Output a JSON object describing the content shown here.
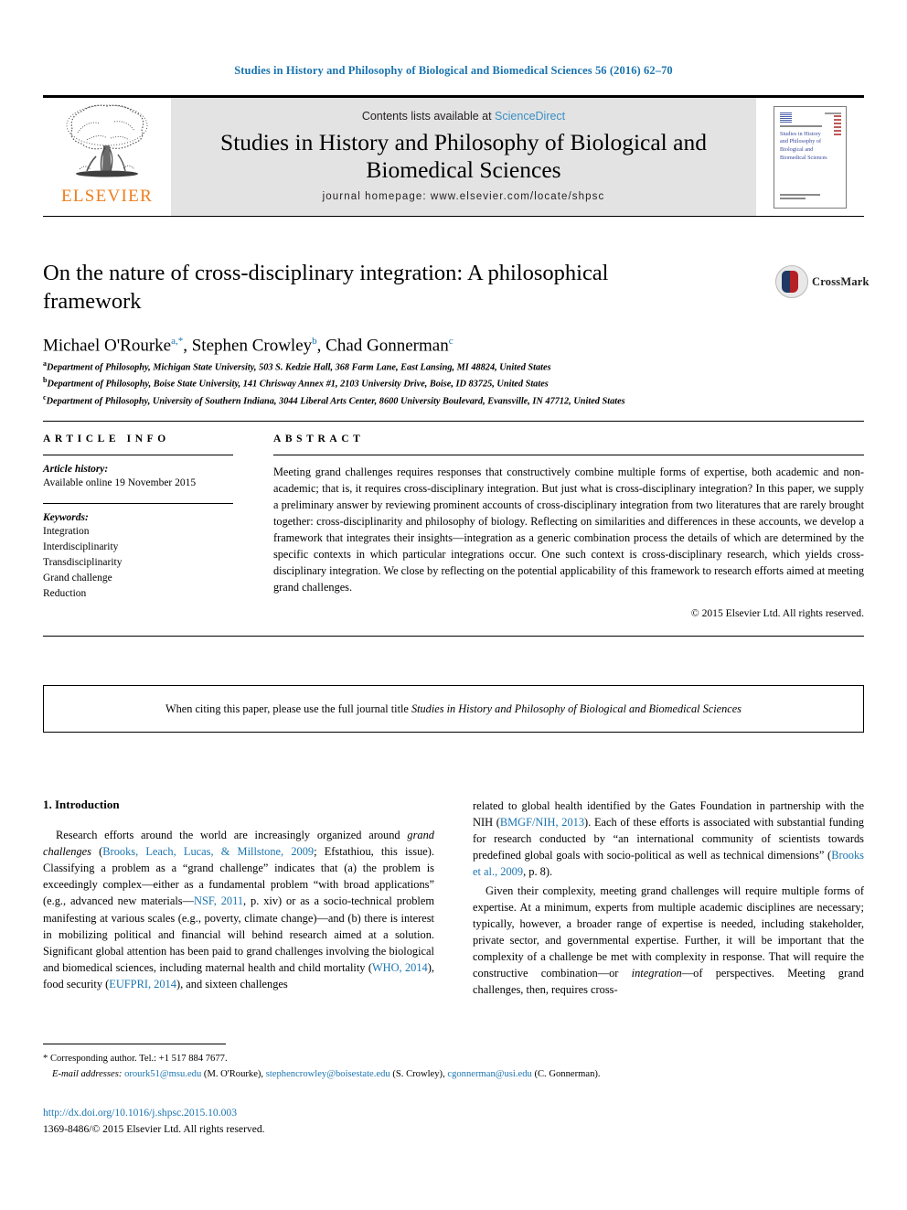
{
  "running_head": "Studies in History and Philosophy of Biological and Biomedical Sciences 56 (2016) 62–70",
  "masthead": {
    "contents_prefix": "Contents lists available at ",
    "sciencedirect": "ScienceDirect",
    "journal_title": "Studies in History and Philosophy of Biological and Biomedical Sciences",
    "homepage": "journal homepage: www.elsevier.com/locate/shpsc",
    "publisher_word": "ELSEVIER",
    "cover_title": "Studies in History and Philosophy of Biological and Biomedical Sciences"
  },
  "article": {
    "title": "On the nature of cross-disciplinary integration: A philosophical framework",
    "authors_html": "Michael O'Rourke<sup>a,*</sup>, Stephen Crowley<sup>b</sup>, Chad Gonnerman<sup>c</sup>",
    "crossmark_label": "CrossMark",
    "affiliations": [
      {
        "marker": "a",
        "text": "Department of Philosophy, Michigan State University, 503 S. Kedzie Hall, 368 Farm Lane, East Lansing, MI 48824, United States"
      },
      {
        "marker": "b",
        "text": "Department of Philosophy, Boise State University, 141 Chrisway Annex #1, 2103 University Drive, Boise, ID 83725, United States"
      },
      {
        "marker": "c",
        "text": "Department of Philosophy, University of Southern Indiana, 3044 Liberal Arts Center, 8600 University Boulevard, Evansville, IN 47712, United States"
      }
    ]
  },
  "article_info": {
    "heading": "ARTICLE INFO",
    "history_label": "Article history:",
    "history_value": "Available online 19 November 2015",
    "keywords_label": "Keywords:",
    "keywords": [
      "Integration",
      "Interdisciplinarity",
      "Transdisciplinarity",
      "Grand challenge",
      "Reduction"
    ]
  },
  "abstract": {
    "heading": "ABSTRACT",
    "body": "Meeting grand challenges requires responses that constructively combine multiple forms of expertise, both academic and non-academic; that is, it requires cross-disciplinary integration. But just what is cross-disciplinary integration? In this paper, we supply a preliminary answer by reviewing prominent accounts of cross-disciplinary integration from two literatures that are rarely brought together: cross-disciplinarity and philosophy of biology. Reflecting on similarities and differences in these accounts, we develop a framework that integrates their insights—integration as a generic combination process the details of which are determined by the specific contexts in which particular integrations occur. One such context is cross-disciplinary research, which yields cross-disciplinary integration. We close by reflecting on the potential applicability of this framework to research efforts aimed at meeting grand challenges.",
    "copyright": "© 2015 Elsevier Ltd. All rights reserved."
  },
  "citation_notice": {
    "prefix": "When citing this paper, please use the full journal title ",
    "journal": "Studies in History and Philosophy of Biological and Biomedical Sciences"
  },
  "introduction": {
    "heading": "1. Introduction",
    "left_paragraph_1_part1": "Research efforts around the world are increasingly organized around ",
    "left_paragraph_1_italic": "grand challenges",
    "left_paragraph_1_part2": " (",
    "left_ref_1": "Brooks, Leach, Lucas, & Millstone, 2009",
    "left_paragraph_1_part3": "; Efstathiou, this issue). Classifying a problem as a “grand challenge” indicates that (a) the problem is exceedingly complex—either as a fundamental problem “with broad applications” (e.g., advanced new materials—",
    "left_ref_2": "NSF, 2011",
    "left_paragraph_1_part4": ", p. xiv) or as a socio-technical problem manifesting at various scales (e.g., poverty, climate change)—and (b) there is interest in mobilizing political and financial will behind research aimed at a solution. Significant global attention has been paid to grand challenges involving the biological and biomedical sciences, including maternal health and child mortality (",
    "left_ref_3": "WHO, 2014",
    "left_paragraph_1_part5": "), food security (",
    "left_ref_4": "EUFPRI, 2014",
    "left_paragraph_1_part6": "), and sixteen challenges",
    "right_paragraph_1_part1": "related to global health identified by the Gates Foundation in partnership with the NIH (",
    "right_ref_1": "BMGF/NIH, 2013",
    "right_paragraph_1_part2": "). Each of these efforts is associated with substantial funding for research conducted by “an international community of scientists towards predefined global goals with socio-political as well as technical dimensions” (",
    "right_ref_2": "Brooks et al., 2009",
    "right_paragraph_1_part3": ", p. 8).",
    "right_paragraph_2_part1": "Given their complexity, meeting grand challenges will require multiple forms of expertise. At a minimum, experts from multiple academic disciplines are necessary; typically, however, a broader range of expertise is needed, including stakeholder, private sector, and governmental expertise. Further, it will be important that the complexity of a challenge be met with complexity in response. That will require the constructive combination—or ",
    "right_paragraph_2_italic": "integration",
    "right_paragraph_2_part2": "—of perspectives. Meeting grand challenges, then, requires cross-"
  },
  "footnotes": {
    "corresponding": "* Corresponding author. Tel.: +1 517 884 7677.",
    "email_label": "E-mail addresses:",
    "emails": [
      {
        "address": "orourk51@msu.edu",
        "name": " (M. O'Rourke), "
      },
      {
        "address": "stephencrowley@boisestate.edu",
        "name": " (S. Crowley), "
      },
      {
        "address": "cgonnerman@usi.edu",
        "name": " (C. Gonnerman)."
      }
    ]
  },
  "bottom": {
    "doi": "http://dx.doi.org/10.1016/j.shpsc.2015.10.003",
    "issn_line": "1369-8486/© 2015 Elsevier Ltd. All rights reserved."
  }
}
